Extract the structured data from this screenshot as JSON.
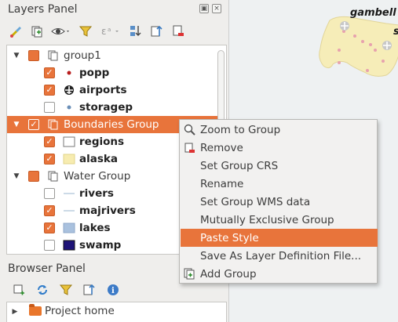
{
  "layers_panel": {
    "title": "Layers Panel",
    "title_buttons": [
      "float",
      "close"
    ],
    "toolbar_icons": [
      "style-brush-icon",
      "add-group-icon",
      "eye-icon",
      "filter-icon",
      "expression-filter-icon",
      "expand-all-icon",
      "collapse-all-icon",
      "remove-layer-icon"
    ],
    "tree": [
      {
        "type": "group",
        "label": "group1",
        "checked": "partial",
        "expanded": true
      },
      {
        "type": "layer",
        "label": "popp",
        "checked": true,
        "symbol": "red-dot"
      },
      {
        "type": "layer",
        "label": "airports",
        "checked": true,
        "symbol": "airport"
      },
      {
        "type": "layer",
        "label": "storagep",
        "checked": false,
        "symbol": "blue-dot"
      },
      {
        "type": "group",
        "label": "Boundaries Group",
        "checked": true,
        "expanded": true,
        "selected": true
      },
      {
        "type": "layer",
        "label": "regions",
        "checked": true,
        "symbol": "white-fill"
      },
      {
        "type": "layer",
        "label": "alaska",
        "checked": true,
        "symbol": "yellow-fill"
      },
      {
        "type": "group",
        "label": "Water Group",
        "checked": "partial",
        "expanded": true
      },
      {
        "type": "layer",
        "label": "rivers",
        "checked": false,
        "symbol": "line"
      },
      {
        "type": "layer",
        "label": "majrivers",
        "checked": true,
        "symbol": "line"
      },
      {
        "type": "layer",
        "label": "lakes",
        "checked": true,
        "symbol": "lightblue-fill"
      },
      {
        "type": "layer",
        "label": "swamp",
        "checked": false,
        "symbol": "navy-fill"
      }
    ]
  },
  "browser_panel": {
    "title": "Browser Panel",
    "toolbar_icons": [
      "add-layer-icon",
      "refresh-icon",
      "filter-icon",
      "collapse-icon",
      "info-icon"
    ],
    "items": [
      {
        "label": "Project home",
        "icon": "folder-icon"
      }
    ]
  },
  "map": {
    "labels": [
      "gambell",
      "s"
    ]
  },
  "context_menu": {
    "items": [
      {
        "label": "Zoom to Group",
        "icon": "zoom-icon",
        "highlighted": false
      },
      {
        "label": "Remove",
        "icon": "remove-icon",
        "highlighted": false
      },
      {
        "label": "Set Group CRS",
        "icon": "",
        "highlighted": false
      },
      {
        "label": "Rename",
        "icon": "",
        "highlighted": false
      },
      {
        "label": "Set Group WMS data",
        "icon": "",
        "highlighted": false
      },
      {
        "label": "Mutually Exclusive Group",
        "icon": "",
        "highlighted": false
      },
      {
        "label": "Paste Style",
        "icon": "",
        "highlighted": true
      },
      {
        "label": "Save As Layer Definition File...",
        "icon": "",
        "highlighted": false
      },
      {
        "label": "Add Group",
        "icon": "add-group-icon",
        "highlighted": false
      }
    ]
  },
  "colors": {
    "accent": "#e8743b",
    "panel_bg": "#efeeec",
    "map_bg": "#eef1f2"
  }
}
